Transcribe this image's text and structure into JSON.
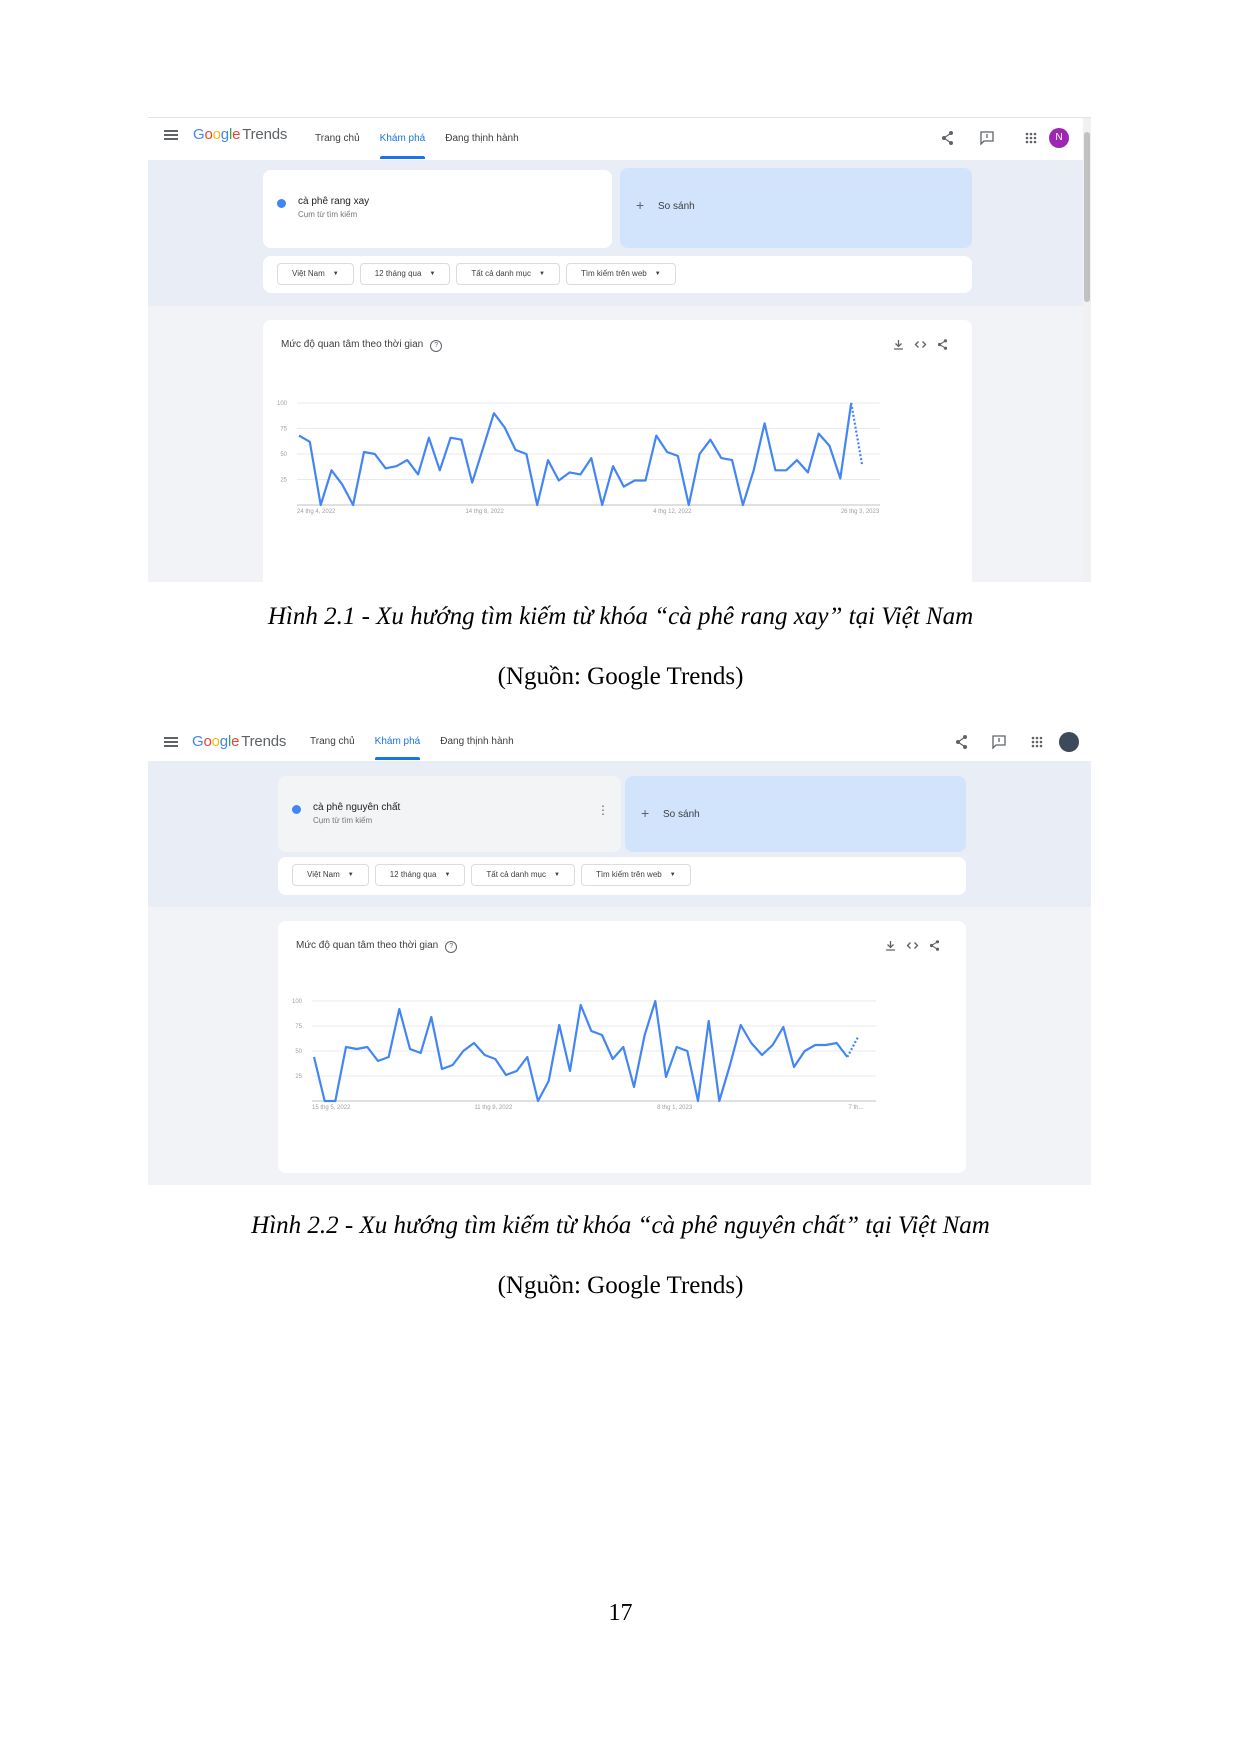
{
  "figures": [
    {
      "app": {
        "logo": {
          "google": [
            "G",
            "o",
            "o",
            "g",
            "l",
            "e"
          ],
          "trends": "Trends"
        },
        "nav": [
          "Trang chủ",
          "Khám phá",
          "Đang thịnh hành"
        ],
        "active_tab": 1,
        "avatar_letter": "N",
        "avatar_color": "#9c27b0"
      },
      "term": {
        "title": "cà phê rang xay",
        "subtitle": "Cụm từ tìm kiếm"
      },
      "compare_label": "So sánh",
      "filters": [
        "Việt Nam",
        "12 tháng qua",
        "Tất cả danh mục",
        "Tìm kiếm trên web"
      ],
      "card_title": "Mức độ quan tâm theo thời gian",
      "chart_data": {
        "type": "line",
        "title": "Mức độ quan tâm theo thời gian",
        "y_ticks": [
          "100",
          "75",
          "50",
          "25"
        ],
        "ylim": [
          0,
          100
        ],
        "x_tick_labels": [
          "24 thg 4, 2022",
          "14 thg 8, 2022",
          "4 thg 12, 2022",
          "26 thg 3, 2023"
        ],
        "values": [
          68,
          62,
          0,
          34,
          20,
          0,
          52,
          50,
          36,
          38,
          44,
          30,
          66,
          34,
          66,
          64,
          22,
          56,
          90,
          76,
          54,
          50,
          0,
          44,
          24,
          32,
          30,
          46,
          0,
          38,
          18,
          24,
          24,
          68,
          52,
          48,
          0,
          50,
          64,
          46,
          44,
          0,
          34,
          80,
          34,
          34,
          44,
          32,
          70,
          58,
          26,
          100
        ],
        "partial_values": [
          100,
          40
        ],
        "color": "#4285f4"
      }
    },
    {
      "app": {
        "logo": {
          "google": [
            "G",
            "o",
            "o",
            "g",
            "l",
            "e"
          ],
          "trends": "Trends"
        },
        "nav": [
          "Trang chủ",
          "Khám phá",
          "Đang thịnh hành"
        ],
        "active_tab": 1,
        "avatar_letter": "",
        "avatar_color": "#3c4a5a"
      },
      "term": {
        "title": "cà phê nguyên chất",
        "subtitle": "Cụm từ tìm kiếm"
      },
      "compare_label": "So sánh",
      "filters": [
        "Việt Nam",
        "12 tháng qua",
        "Tất cả danh mục",
        "Tìm kiếm trên web"
      ],
      "card_title": "Mức độ quan tâm theo thời gian",
      "chart_data": {
        "type": "line",
        "title": "Mức độ quan tâm theo thời gian",
        "y_ticks": [
          "100",
          "75",
          "50",
          "25"
        ],
        "ylim": [
          0,
          100
        ],
        "x_tick_labels": [
          "15 thg 5, 2022",
          "11 thg 9, 2022",
          "8 thg 1, 2023",
          "7 th..."
        ],
        "values": [
          44,
          0,
          0,
          54,
          52,
          54,
          40,
          44,
          92,
          52,
          48,
          84,
          32,
          36,
          50,
          58,
          46,
          42,
          26,
          30,
          44,
          0,
          20,
          76,
          30,
          96,
          70,
          66,
          42,
          54,
          14,
          66,
          100,
          24,
          54,
          50,
          0,
          80,
          0,
          36,
          76,
          58,
          46,
          56,
          74,
          34,
          50,
          56,
          56,
          58,
          44
        ],
        "partial_values": [
          44,
          64
        ],
        "color": "#4285f4"
      }
    }
  ],
  "captions": [
    {
      "figure": "Hình 2.1 - Xu hướng tìm kiếm từ khóa “cà phê rang xay” tại Việt Nam",
      "source": "(Nguồn: Google Trends)"
    },
    {
      "figure": "Hình 2.2 - Xu hướng tìm kiếm từ khóa “cà phê nguyên chất” tại Việt Nam",
      "source": "(Nguồn: Google Trends)"
    }
  ],
  "page_number": "17",
  "logo_colors": [
    "#4285f4",
    "#ea4335",
    "#fbbc05",
    "#4285f4",
    "#34a853",
    "#ea4335"
  ]
}
